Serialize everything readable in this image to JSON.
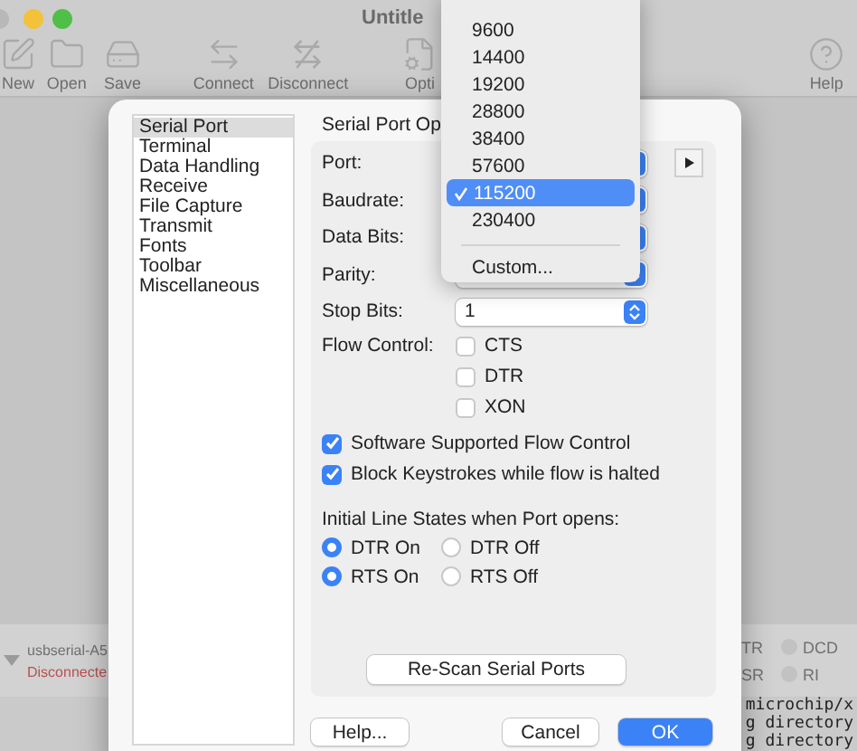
{
  "window": {
    "title": "Untitle"
  },
  "toolbar": [
    {
      "label": "New"
    },
    {
      "label": "Open"
    },
    {
      "label": "Save"
    },
    {
      "label": "Connect"
    },
    {
      "label": "Disconnect"
    },
    {
      "label": "Opti"
    },
    {
      "label": "Help"
    }
  ],
  "status": {
    "port": "usbserial-A5",
    "state": "Disconnecte",
    "signals": [
      {
        "label": "TR"
      },
      {
        "label": "DCD"
      },
      {
        "label": "SR"
      },
      {
        "label": "RI"
      }
    ]
  },
  "terminal": [
    "microchip/x",
    "g directory",
    "g directory"
  ],
  "dialog": {
    "categories": [
      {
        "label": "Serial Port",
        "selected": true
      },
      {
        "label": "Terminal",
        "selected": false
      },
      {
        "label": "Data Handling",
        "selected": false
      },
      {
        "label": "Receive",
        "selected": false
      },
      {
        "label": "File Capture",
        "selected": false
      },
      {
        "label": "Transmit",
        "selected": false
      },
      {
        "label": "Fonts",
        "selected": false
      },
      {
        "label": "Toolbar",
        "selected": false
      },
      {
        "label": "Miscellaneous",
        "selected": false
      }
    ],
    "heading": "Serial Port Op",
    "fields": [
      {
        "label": "Port:"
      },
      {
        "label": "Baudrate:"
      },
      {
        "label": "Data Bits:"
      },
      {
        "label": "Parity:"
      },
      {
        "label": "Stop Bits:",
        "value": "1"
      }
    ],
    "flow_control": {
      "label": "Flow Control:",
      "options": [
        {
          "label": "CTS",
          "checked": false
        },
        {
          "label": "DTR",
          "checked": false
        },
        {
          "label": "XON",
          "checked": false
        }
      ]
    },
    "options": [
      {
        "label": "Software Supported Flow Control",
        "checked": true
      },
      {
        "label": "Block Keystrokes while flow is halted",
        "checked": true
      }
    ],
    "line_states": {
      "label": "Initial Line States when Port opens:",
      "groups": [
        {
          "options": [
            {
              "label": "DTR On",
              "selected": true
            },
            {
              "label": "DTR Off",
              "selected": false
            }
          ]
        },
        {
          "options": [
            {
              "label": "RTS On",
              "selected": true
            },
            {
              "label": "RTS Off",
              "selected": false
            }
          ]
        }
      ]
    },
    "rescan_button": "Re-Scan Serial Ports",
    "buttons": [
      {
        "label": "Help...",
        "kind": "normal"
      },
      {
        "label": "Cancel",
        "kind": "normal"
      },
      {
        "label": "OK",
        "kind": "default"
      }
    ]
  },
  "baud_menu": {
    "items": [
      {
        "label": "9600",
        "selected": false
      },
      {
        "label": "14400",
        "selected": false
      },
      {
        "label": "19200",
        "selected": false
      },
      {
        "label": "28800",
        "selected": false
      },
      {
        "label": "38400",
        "selected": false
      },
      {
        "label": "57600",
        "selected": false
      },
      {
        "label": "115200",
        "selected": true
      },
      {
        "label": "230400",
        "selected": false
      }
    ],
    "custom": "Custom..."
  }
}
